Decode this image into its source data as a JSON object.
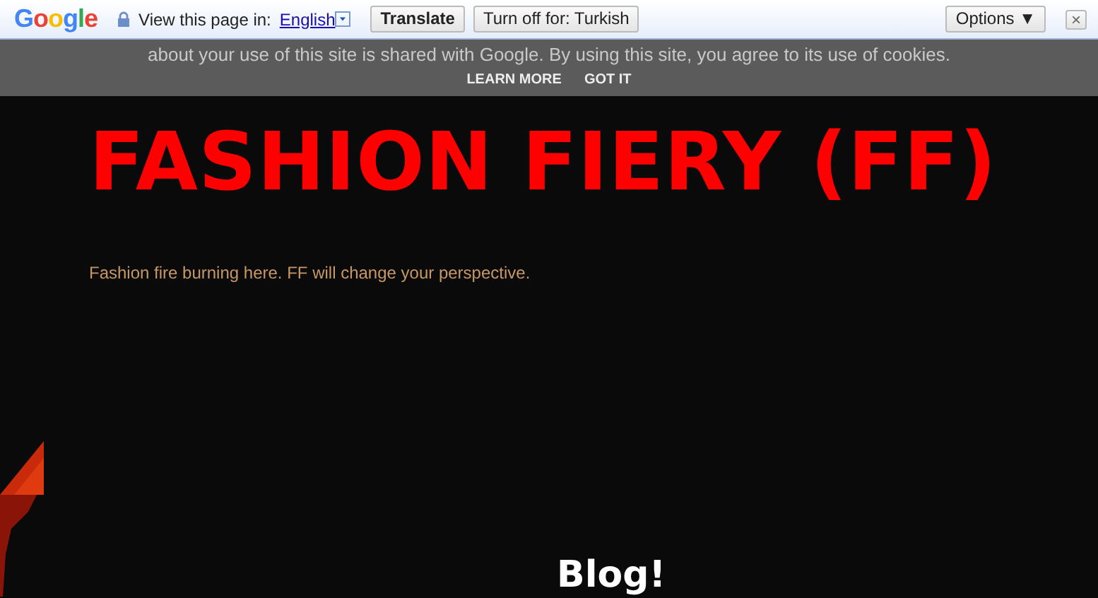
{
  "translate_bar": {
    "logo": "Google",
    "label": "View this page in:",
    "language": "English",
    "translate_button": "Translate",
    "turn_off_button": "Turn off for: Turkish",
    "options_button": "Options ▼",
    "close": "×"
  },
  "cookie_notice": {
    "text": "about your use of this site is shared with Google. By using this site, you agree to its use of cookies.",
    "links": [
      "LEARN MORE",
      "GOT IT"
    ]
  },
  "blog": {
    "title": "FASHION FIERY (FF)",
    "description": "Fashion fire burning here. FF will change your perspective.",
    "section_heading": "Blog!"
  }
}
